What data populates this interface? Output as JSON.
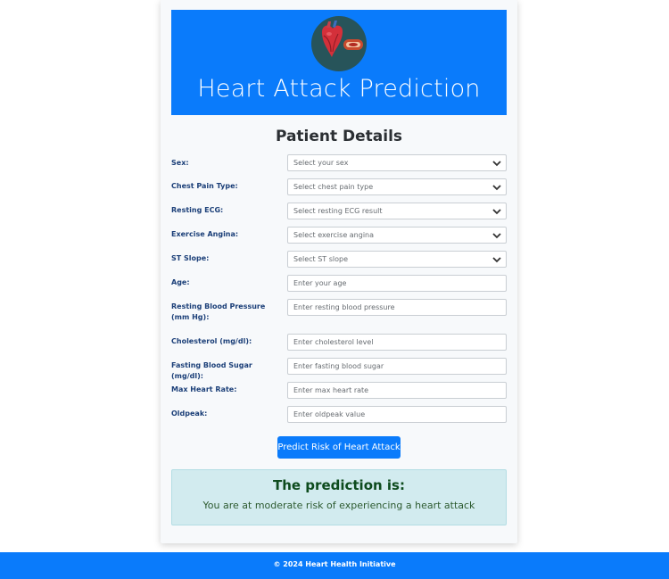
{
  "header": {
    "title": "Heart Attack Prediction",
    "logo_icon": "heart-anatomy-icon",
    "background": "#0a7bfb"
  },
  "form": {
    "section_title": "Patient Details",
    "fields": [
      {
        "label": "Sex:",
        "type": "select",
        "placeholder": "Select your sex"
      },
      {
        "label": "Chest Pain Type:",
        "type": "select",
        "placeholder": "Select chest pain type"
      },
      {
        "label": "Resting ECG:",
        "type": "select",
        "placeholder": "Select resting ECG result"
      },
      {
        "label": "Exercise Angina:",
        "type": "select",
        "placeholder": "Select exercise angina"
      },
      {
        "label": "ST Slope:",
        "type": "select",
        "placeholder": "Select ST slope"
      },
      {
        "label": "Age:",
        "type": "input",
        "placeholder": "Enter your age"
      },
      {
        "label": "Resting Blood Pressure (mm Hg):",
        "type": "input",
        "placeholder": "Enter resting blood pressure"
      },
      {
        "label": "Cholesterol (mg/dl):",
        "type": "input",
        "placeholder": "Enter cholesterol level"
      },
      {
        "label": "Fasting Blood Sugar (mg/dl):",
        "type": "input",
        "placeholder": "Enter fasting blood sugar"
      },
      {
        "label": "Max Heart Rate:",
        "type": "input",
        "placeholder": "Enter max heart rate"
      },
      {
        "label": "Oldpeak:",
        "type": "input",
        "placeholder": "Enter oldpeak value"
      }
    ],
    "submit_label": "Predict Risk of Heart Attack"
  },
  "result": {
    "title": "The prediction is:",
    "text": "You are at moderate risk of experiencing a heart attack"
  },
  "footer": {
    "text": "© 2024 Heart Health Initiative"
  },
  "colors": {
    "accent": "#0a7bfb",
    "label": "#1b3f78",
    "result_bg": "#d2ebef",
    "result_title": "#0d4b1d"
  }
}
